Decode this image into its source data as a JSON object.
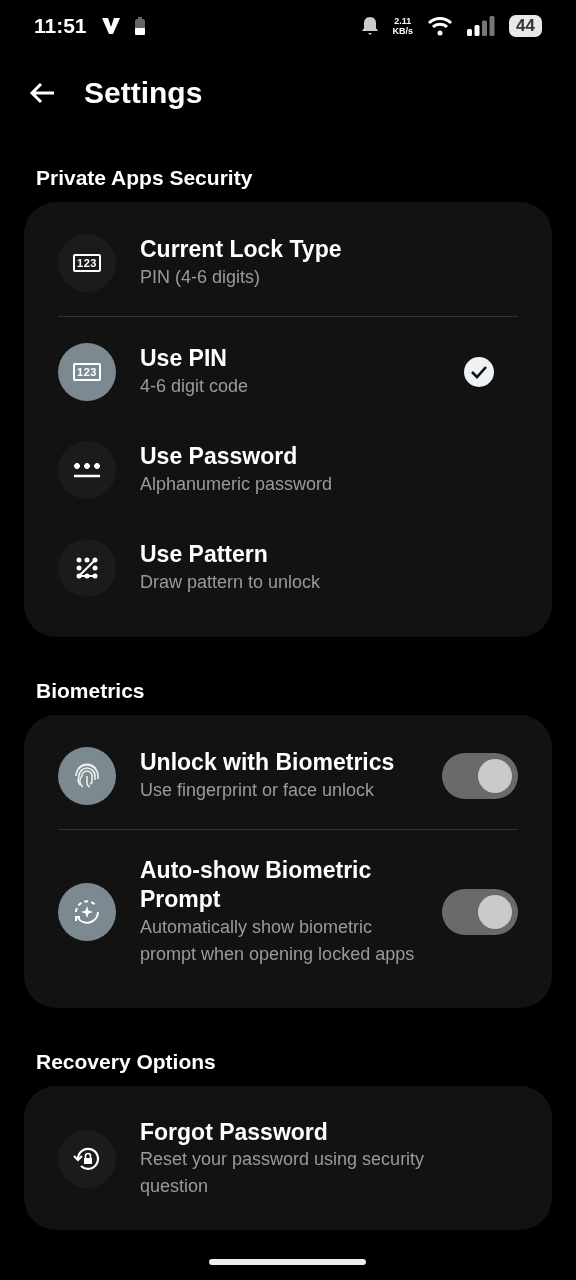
{
  "status_bar": {
    "time": "11:51",
    "speed_value": "2.11",
    "speed_unit": "KB/s",
    "battery": "44"
  },
  "header": {
    "title": "Settings"
  },
  "sections": [
    {
      "title": "Private Apps Security",
      "items": [
        {
          "kind": "info",
          "icon_label": "123",
          "title": "Current Lock Type",
          "subtitle": "PIN (4-6 digits)"
        },
        {
          "kind": "option",
          "icon_label": "123",
          "title": "Use PIN",
          "subtitle": "4-6 digit code",
          "selected": true
        },
        {
          "kind": "option",
          "title": "Use Password",
          "subtitle": "Alphanumeric password",
          "selected": false
        },
        {
          "kind": "option",
          "title": "Use Pattern",
          "subtitle": "Draw pattern to unlock",
          "selected": false
        }
      ]
    },
    {
      "title": "Biometrics",
      "items": [
        {
          "kind": "toggle",
          "title": "Unlock with Biometrics",
          "subtitle": "Use fingerprint or face unlock",
          "on": true
        },
        {
          "kind": "toggle",
          "title": "Auto-show Biometric Prompt",
          "subtitle": "Automatically show biometric prompt when opening locked apps",
          "on": true
        }
      ]
    },
    {
      "title": "Recovery Options",
      "items": [
        {
          "kind": "info",
          "title": "Forgot Password",
          "subtitle": "Reset your password using security question"
        }
      ]
    }
  ]
}
